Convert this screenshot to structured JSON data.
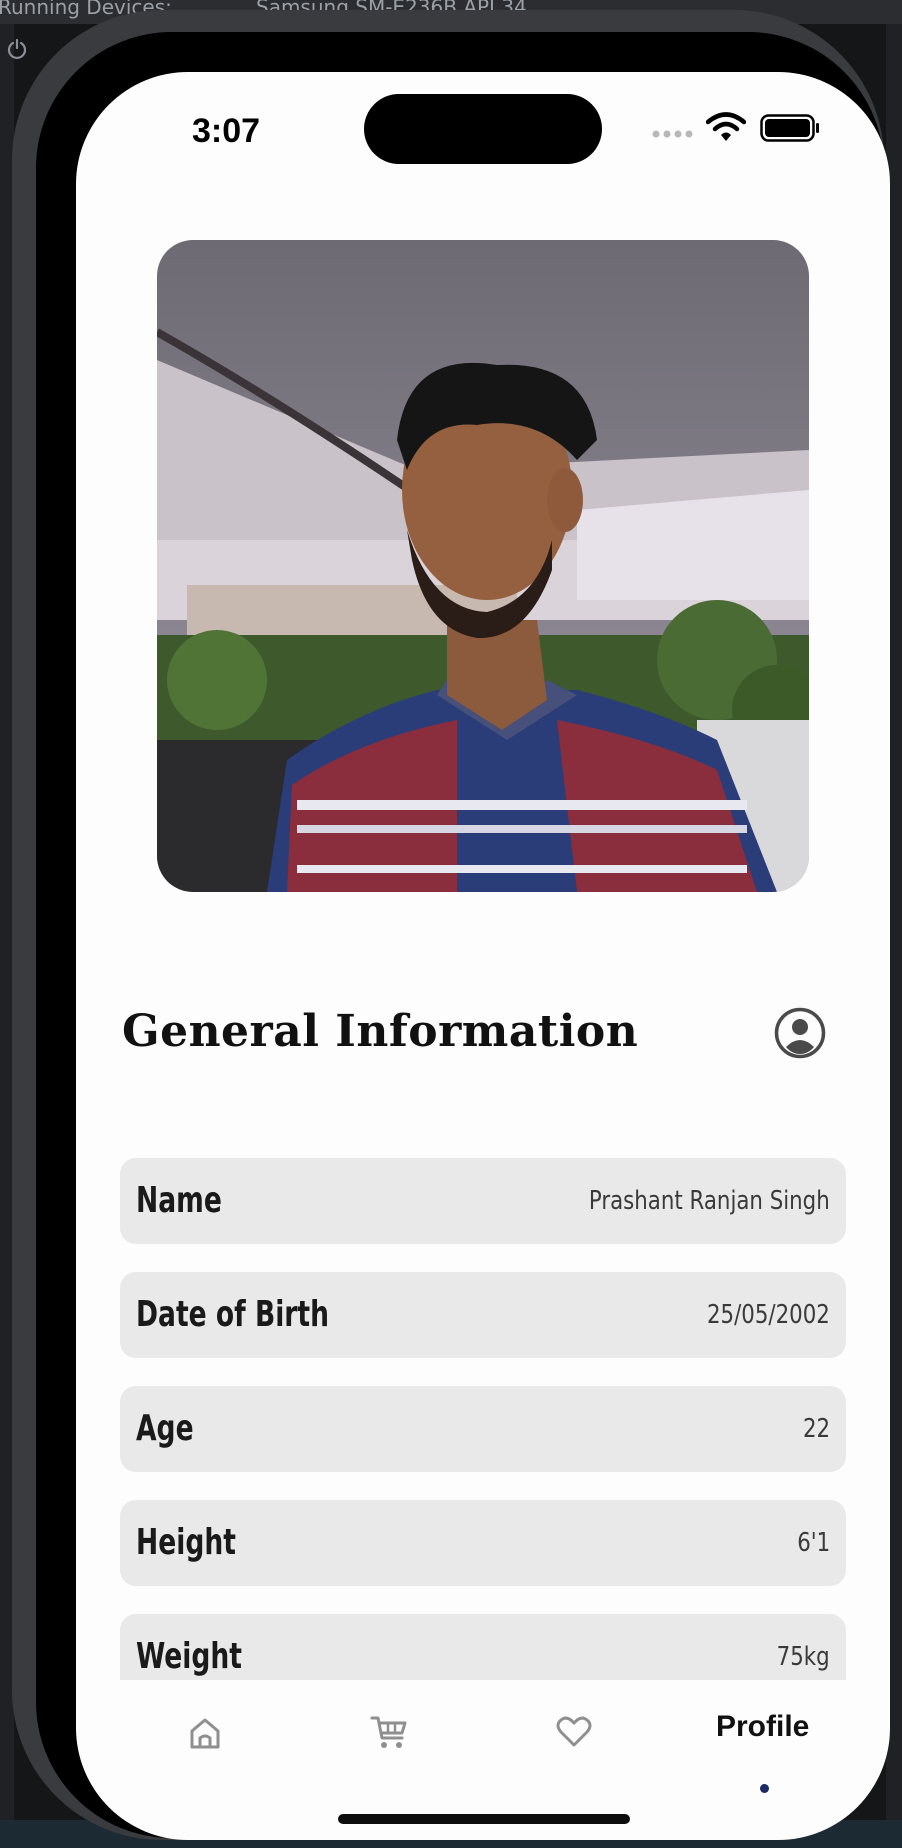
{
  "ide": {
    "tab_left": "Running Devices:",
    "tab_device": "Samsung SM-E236B API 34"
  },
  "status_bar": {
    "time": "3:07"
  },
  "profile": {
    "section_title": "General Information",
    "fields": [
      {
        "label": "Name",
        "value": "Prashant Ranjan Singh"
      },
      {
        "label": "Date of Birth",
        "value": "25/05/2002"
      },
      {
        "label": "Age",
        "value": "22"
      },
      {
        "label": "Height",
        "value": "6'1"
      },
      {
        "label": "Weight",
        "value": "75kg"
      }
    ]
  },
  "bottom_nav": {
    "items": [
      {
        "icon": "home-icon"
      },
      {
        "icon": "cart-icon"
      },
      {
        "icon": "heart-icon"
      },
      {
        "label": "Profile",
        "active": true
      }
    ]
  },
  "colors": {
    "accent": "#1c2a66",
    "row_bg": "#e9e9e9",
    "screen_bg": "#fdfdfd"
  }
}
